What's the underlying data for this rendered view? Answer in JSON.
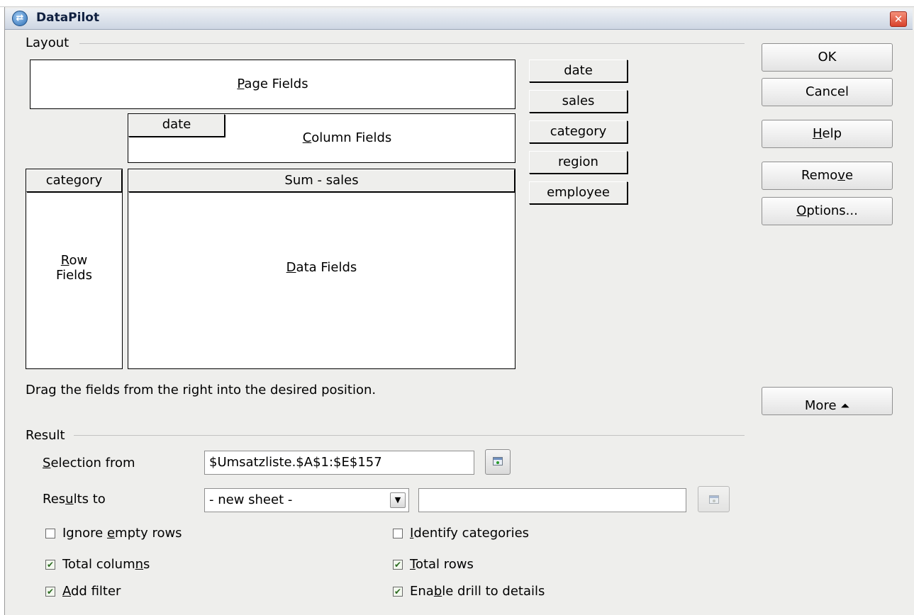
{
  "window": {
    "title": "DataPilot",
    "close_glyph": "✕",
    "app_icon": "datapilot-app-icon"
  },
  "layout": {
    "section_label": "Layout",
    "page_fields": {
      "pre": "",
      "mn": "P",
      "post": "age Fields"
    },
    "column_fields": {
      "pre": "",
      "mn": "C",
      "post": "olumn Fields"
    },
    "row_fields": {
      "line1_pre": "",
      "line1_mn": "R",
      "line1_post": "ow",
      "line2": "Fields"
    },
    "data_fields": {
      "pre": "",
      "mn": "D",
      "post": "ata Fields"
    },
    "column_field_item": "date",
    "row_field_item": "category",
    "data_field_item": "Sum - sales",
    "available_fields": [
      "date",
      "sales",
      "category",
      "region",
      "employee"
    ],
    "hint": "Drag the fields from the right into the desired position."
  },
  "buttons": {
    "ok": "OK",
    "cancel": "Cancel",
    "help": {
      "pre": "",
      "mn": "H",
      "post": "elp"
    },
    "remove": {
      "pre": "Remo",
      "mn": "v",
      "post": "e"
    },
    "options": {
      "pre": "",
      "mn": "O",
      "post": "ptions..."
    },
    "more": {
      "label": "More",
      "icon": "⏶"
    }
  },
  "result": {
    "section_label": "Result",
    "selection_from": {
      "pre": "",
      "mn": "S",
      "post": "election from",
      "value": "$Umsatzliste.$A$1:$E$157"
    },
    "results_to": {
      "pre": "Res",
      "mn": "u",
      "post": "lts to",
      "selected": "- new sheet -",
      "target_value": ""
    },
    "options": {
      "ignore_empty_rows": {
        "pre": "Ignore ",
        "mn": "e",
        "post": "mpty rows",
        "checked": false
      },
      "identify_categories": {
        "pre": "",
        "mn": "I",
        "post": "dentify categories",
        "checked": false
      },
      "total_columns": {
        "pre": "Total colum",
        "mn": "n",
        "post": "s",
        "checked": true
      },
      "total_rows": {
        "pre": "",
        "mn": "T",
        "post": "otal rows",
        "checked": true
      },
      "add_filter": {
        "pre": "",
        "mn": "A",
        "post": "dd filter",
        "checked": true
      },
      "enable_drill": {
        "pre": "Ena",
        "mn": "b",
        "post": "le drill to details",
        "checked": true
      }
    }
  },
  "colors": {
    "window_bg": "#eeeeec",
    "title_gradient_top": "#eef1f5",
    "close_red": "#d8432c",
    "check_green": "#2a6a1f"
  }
}
